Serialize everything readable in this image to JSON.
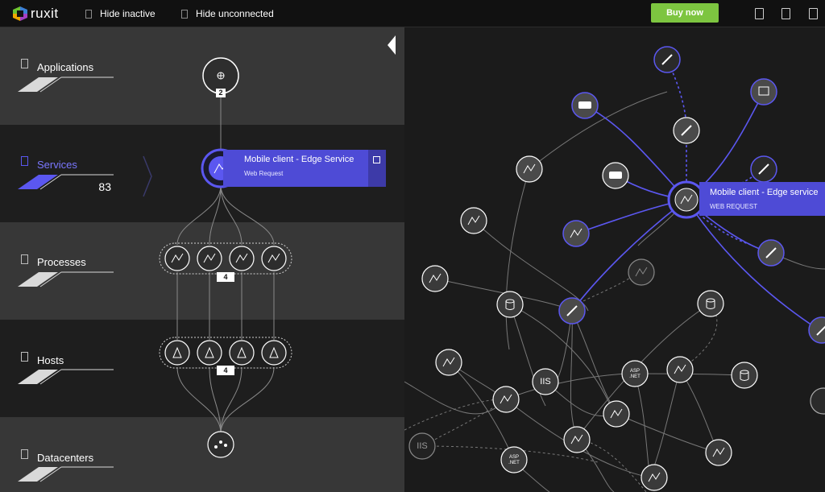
{
  "app": {
    "logo_text": "ruxit"
  },
  "topbar": {
    "hide_inactive": "Hide inactive",
    "hide_unconnected": "Hide unconnected",
    "buy_label": "Buy now",
    "buy_color": "#7dc540",
    "icons": [
      "page-icon",
      "page-icon",
      "page-icon"
    ]
  },
  "layers": [
    {
      "label": "Applications",
      "count": "",
      "active": false
    },
    {
      "label": "Services",
      "count": "83",
      "active": true
    },
    {
      "label": "Processes",
      "count": "",
      "active": false
    },
    {
      "label": "Hosts",
      "count": "",
      "active": false
    },
    {
      "label": "Datacenters",
      "count": "",
      "active": false
    }
  ],
  "accent_color": "#5b57f0",
  "app_node": {
    "badge": "2",
    "icon": "globe-icon"
  },
  "service_card": {
    "title": "Mobile client - Edge Service",
    "subtitle": "Web Request",
    "icon": "external-link-icon"
  },
  "process_group": {
    "badge": "4"
  },
  "host_group": {
    "badge": "4"
  },
  "datacenter_node": {
    "icon": "network-icon"
  },
  "graph": {
    "selected_title": "Mobile client - Edge service",
    "selected_subtitle": "WEB REQUEST",
    "iis_label": "IIS",
    "aspnet_label_top": "ASP",
    "aspnet_label_bottom": ".NET"
  }
}
